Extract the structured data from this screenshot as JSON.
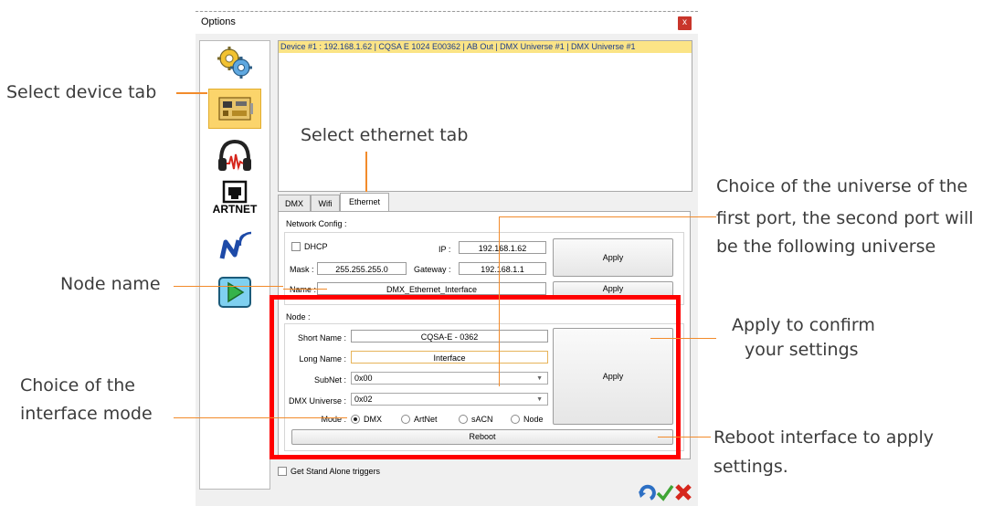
{
  "window": {
    "title": "Options",
    "close_symbol": "x"
  },
  "sidebar": {
    "items": [
      {
        "name": "settings",
        "icon": "gears-icon"
      },
      {
        "name": "devices",
        "icon": "device-card-icon",
        "selected": true
      },
      {
        "name": "audio",
        "icon": "headphones-icon"
      },
      {
        "name": "artnet",
        "icon": "artnet-icon",
        "label": "ARTNET"
      },
      {
        "name": "network",
        "icon": "network-wireless-icon"
      },
      {
        "name": "player",
        "icon": "play-icon"
      }
    ]
  },
  "device_list": {
    "rows": [
      "Device #1 : 192.168.1.62 | CQSA E 1024 E00362 | AB Out | DMX Universe #1 | DMX Universe #1"
    ]
  },
  "tabs": [
    {
      "label": "DMX"
    },
    {
      "label": "Wifi"
    },
    {
      "label": "Ethernet",
      "active": true
    }
  ],
  "network_config": {
    "legend": "Network Config :",
    "dhcp_label": "DHCP",
    "dhcp_checked": false,
    "ip_label": "IP :",
    "ip_value": "192.168.1.62",
    "mask_label": "Mask :",
    "mask_value": "255.255.255.0",
    "gateway_label": "Gateway :",
    "gateway_value": "192.168.1.1",
    "apply_label": "Apply",
    "name_label": "Name :",
    "name_value": "DMX_Ethernet_Interface",
    "name_apply_label": "Apply"
  },
  "node": {
    "legend": "Node :",
    "short_name_label": "Short Name :",
    "short_name_value": "CQSA-E - 0362",
    "long_name_label": "Long Name :",
    "long_name_value": "Interface",
    "subnet_label": "SubNet :",
    "subnet_value": "0x00",
    "universe_label": "DMX Universe :",
    "universe_value": "0x02",
    "mode_label": "Mode :",
    "modes": [
      "DMX",
      "ArtNet",
      "sACN",
      "Node"
    ],
    "selected_mode": "DMX",
    "apply_label": "Apply",
    "reboot_label": "Reboot"
  },
  "footer": {
    "standalone_label": "Get Stand Alone triggers",
    "standalone_checked": false
  },
  "annotations": {
    "select_device_tab": "Select device tab",
    "select_ethernet_tab": "Select ethernet tab",
    "universe_choice_line1": "Choice of the universe of the",
    "universe_choice_line2": "first port, the second port will",
    "universe_choice_line3": "be the following universe",
    "node_name": "Node name",
    "apply_confirm_line1": "Apply to confirm",
    "apply_confirm_line2": "your settings",
    "interface_mode_line1": "Choice of the",
    "interface_mode_line2": "interface mode",
    "reboot_line1": "Reboot interface to apply",
    "reboot_line2": "settings."
  },
  "colors": {
    "annotation_line": "#f28b2b",
    "highlight_box": "#ff0000",
    "selected_row": "#fbe486",
    "selected_sidebar": "#fbd46b"
  }
}
